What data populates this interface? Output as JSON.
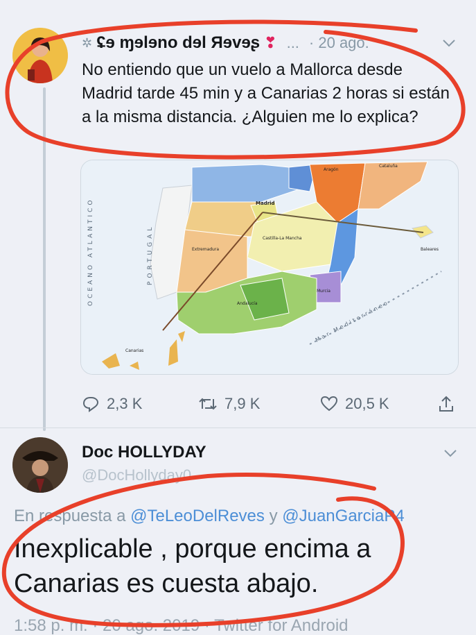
{
  "tweet1": {
    "display_name": "ʢɘ ɱɘlɘno dɘl Яɘvɘʂ",
    "menu_dots": "...",
    "date": "· 20 ago.",
    "text": "No entiendo que un vuelo a Mallorca desde Madrid tarde 45 min y a Canarias 2 horas si están a la misma distancia. ¿Alguien me lo explica?",
    "reply_count": "2,3 K",
    "retweet_count": "7,9 K",
    "like_count": "20,5 K"
  },
  "map": {
    "labels": {
      "ocean": "OCEANO ATLANTICO",
      "portugal": "PORTUGAL",
      "madrid": "Madrid",
      "castilla_la_mancha": "Castilla-La Mancha",
      "extremadura": "Extremadura",
      "andalucia": "Andalucía",
      "murcia": "Murcia",
      "baleares": "Baleares",
      "canarias": "Canarias",
      "mediterraneo": "Mar Mediterráneo",
      "aragon": "Aragón",
      "cataluna": "Cataluña"
    }
  },
  "reply": {
    "display_name": "Doc HOLLYDAY",
    "handle": "@DocHollyday0",
    "reply_prefix": "En respuesta a",
    "mention1": "@TeLeoDelReves",
    "joiner": "y",
    "mention2": "@JuanGarciaP4",
    "text": "Inexplicable , porque encima a Canarias es cuesta abajo.",
    "footer": "1:58 p. m. · 20 ago. 2019 · Twitter for Android"
  },
  "colors": {
    "highlight_red": "#e8402a",
    "link_blue": "#4c8ed6",
    "muted_gray": "#8899a6"
  }
}
